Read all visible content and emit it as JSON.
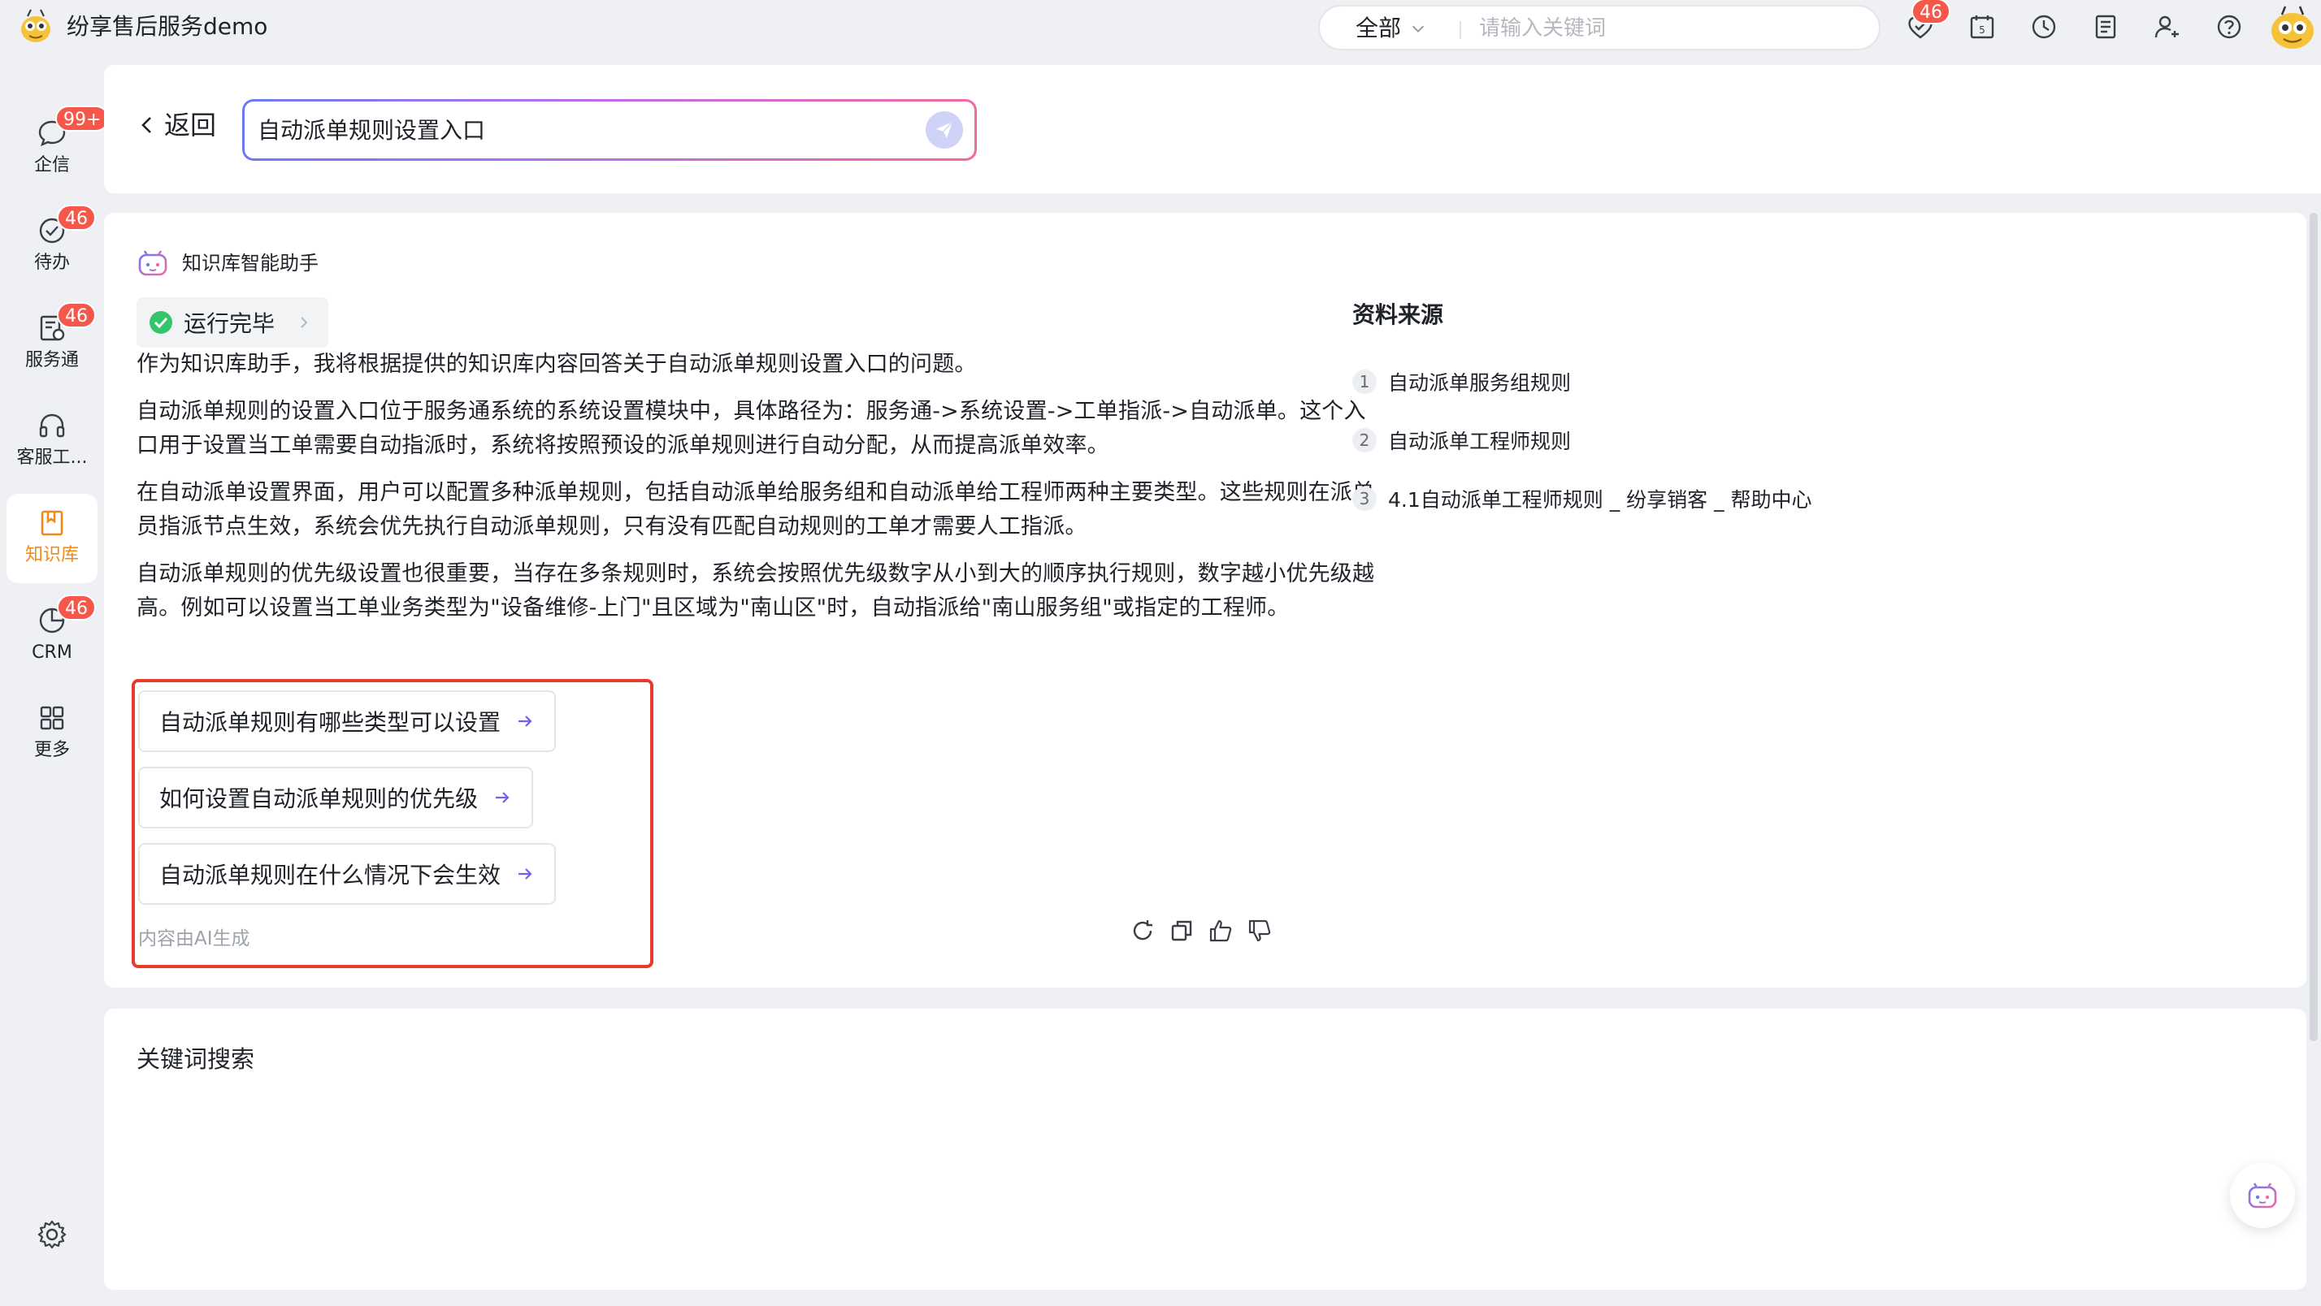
{
  "app": {
    "title": "纷享售后服务demo"
  },
  "search": {
    "scope": "全部",
    "placeholder": "请输入关键词"
  },
  "topbar": {
    "notification_badge": "46"
  },
  "sidebar": {
    "items": [
      {
        "label": "企信",
        "badge": "99+",
        "icon": "chat-bubble-icon"
      },
      {
        "label": "待办",
        "badge": "46",
        "icon": "check-circle-icon"
      },
      {
        "label": "服务通",
        "badge": "46",
        "icon": "service-doc-icon"
      },
      {
        "label": "客服工...",
        "badge": "",
        "icon": "headset-icon"
      },
      {
        "label": "知识库",
        "badge": "",
        "icon": "book-icon",
        "active": true
      },
      {
        "label": "CRM",
        "badge": "46",
        "icon": "pie-chart-icon"
      },
      {
        "label": "更多",
        "badge": "",
        "icon": "grid-icon"
      }
    ]
  },
  "header": {
    "back_label": "返回",
    "query_value": "自动派单规则设置入口"
  },
  "assistant": {
    "name": "知识库智能助手",
    "status": "运行完毕",
    "paragraphs": [
      "作为知识库助手，我将根据提供的知识库内容回答关于自动派单规则设置入口的问题。",
      "自动派单规则的设置入口位于服务通系统的系统设置模块中，具体路径为：服务通->系统设置->工单指派->自动派单。这个入口用于设置当工单需要自动指派时，系统将按照预设的派单规则进行自动分配，从而提高派单效率。",
      "在自动派单设置界面，用户可以配置多种派单规则，包括自动派单给服务组和自动派单给工程师两种主要类型。这些规则在派单员指派节点生效，系统会优先执行自动派单规则，只有没有匹配自动规则的工单才需要人工指派。",
      "自动派单规则的优先级设置也很重要，当存在多条规则时，系统会按照优先级数字从小到大的顺序执行规则，数字越小优先级越高。例如可以设置当工单业务类型为\"设备维修-上门\"且区域为\"南山区\"时，自动指派给\"南山服务组\"或指定的工程师。"
    ],
    "followups": [
      "自动派单规则有哪些类型可以设置",
      "如何设置自动派单规则的优先级",
      "自动派单规则在什么情况下会生效"
    ],
    "ai_note": "内容由AI生成"
  },
  "sources": {
    "title": "资料来源",
    "items": [
      {
        "num": "1",
        "label": "自动派单服务组规则"
      },
      {
        "num": "2",
        "label": "自动派单工程师规则"
      },
      {
        "num": "3",
        "label": "4.1自动派单工程师规则 _ 纷享销客 _ 帮助中心"
      }
    ]
  },
  "keyword": {
    "title": "关键词搜索"
  },
  "colors": {
    "accent": "#f08a1a",
    "badge": "#f5574a",
    "highlight_border": "#e8392f",
    "link_arrow": "#7b5cf0"
  }
}
